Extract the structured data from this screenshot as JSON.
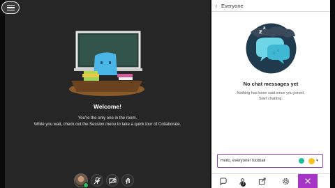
{
  "welcome": {
    "title": "Welcome!",
    "line1": "You're the only one in the room.",
    "line2": "While you wait, check out the Session menu to take a quick tour of Collaborate."
  },
  "panel": {
    "title": "Everyone",
    "empty_title": "No chat messages yet",
    "empty_line1": "Nothing has been said since you joined.",
    "empty_line2": "Start chatting."
  },
  "chat_input": {
    "value": "Hello, everyone! football"
  },
  "footer": {
    "attendee_count": "1"
  },
  "colors": {
    "accent": "#a634c6",
    "chat_bubble": "#6fd6e8",
    "status_green": "#2cbf58"
  },
  "icons": [
    "menu-icon",
    "microphone-off-icon",
    "camera-off-icon",
    "hand-raise-icon",
    "chat-icon",
    "attendees-icon",
    "share-icon",
    "settings-icon",
    "close-icon",
    "emoji-icon"
  ]
}
